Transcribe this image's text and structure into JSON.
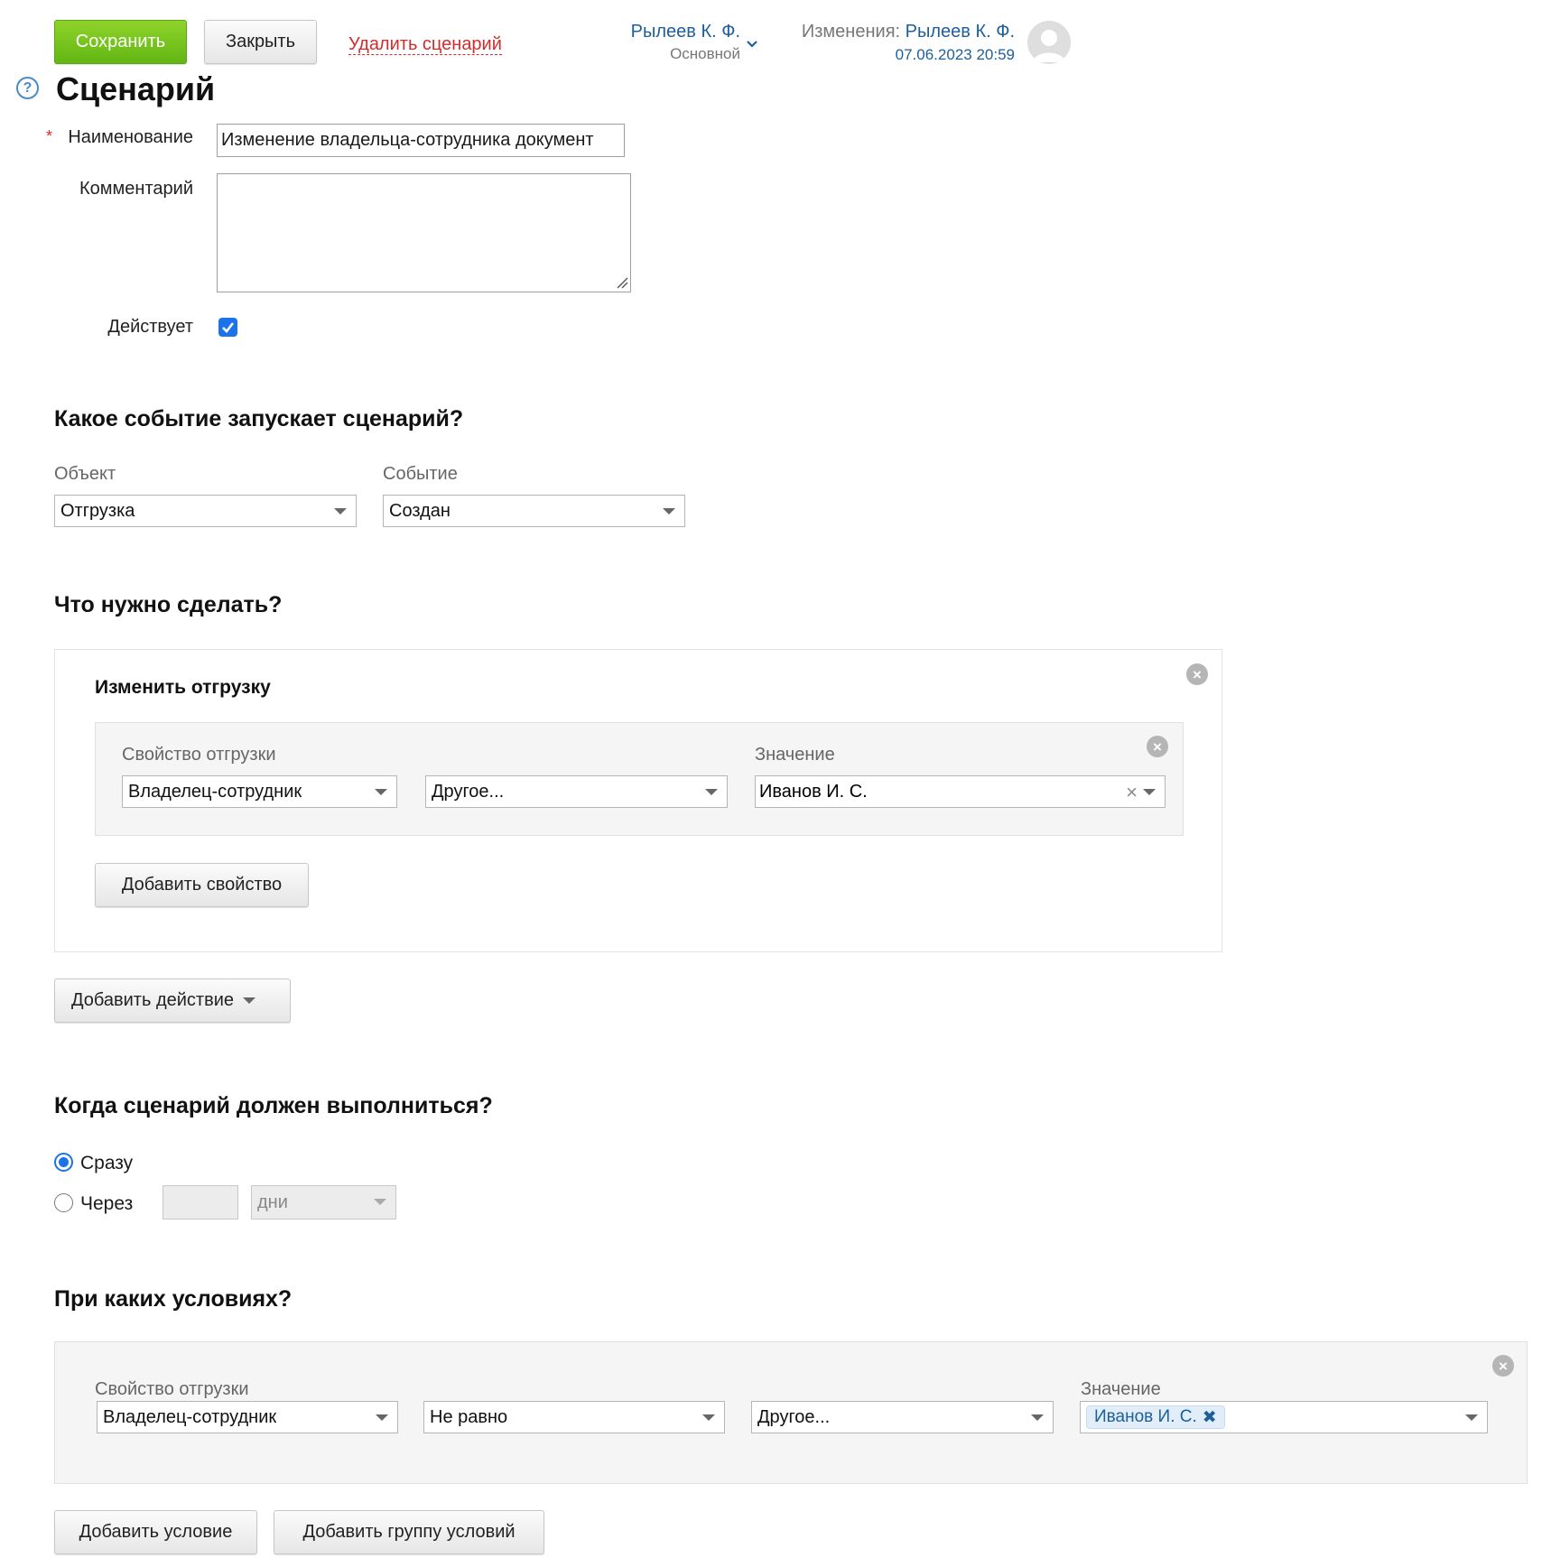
{
  "toolbar": {
    "save_label": "Сохранить",
    "close_label": "Закрыть",
    "delete_label": "Удалить сценарий"
  },
  "user": {
    "name": "Рылеев К. Ф.",
    "role": "Основной"
  },
  "changes": {
    "prefix": "Изменения:",
    "author": "Рылеев К. Ф.",
    "timestamp": "07.06.2023 20:59"
  },
  "page": {
    "help_glyph": "?",
    "title": "Сценарий"
  },
  "form": {
    "required_mark": "*",
    "name_label": "Наименование",
    "name_value": "Изменение владельца-сотрудника документ",
    "comment_label": "Комментарий",
    "comment_value": "",
    "active_label": "Действует",
    "active_checked": true
  },
  "trigger": {
    "heading": "Какое событие запускает сценарий?",
    "object_label": "Объект",
    "object_value": "Отгрузка",
    "event_label": "Событие",
    "event_value": "Создан"
  },
  "actions": {
    "heading": "Что нужно сделать?",
    "action_title": "Изменить отгрузку",
    "property_label": "Свойство отгрузки",
    "property_value": "Владелец-сотрудник",
    "mode_value": "Другое...",
    "value_label": "Значение",
    "value_value": "Иванов И. С.",
    "add_property_label": "Добавить свойство",
    "add_action_label": "Добавить действие"
  },
  "timing": {
    "heading": "Когда сценарий должен выполниться?",
    "option_now": "Сразу",
    "option_after": "Через",
    "selected": "now",
    "after_amount": "",
    "after_unit": "дни"
  },
  "conditions": {
    "heading": "При каких условиях?",
    "property_label": "Свойство отгрузки",
    "property_value": "Владелец-сотрудник",
    "operator_value": "Не равно",
    "mode_value": "Другое...",
    "value_label": "Значение",
    "value_tag": "Иванов И. С.",
    "add_condition_label": "Добавить условие",
    "add_group_label": "Добавить группу условий"
  },
  "colors": {
    "accent_green": "#62b613",
    "link_blue": "#1d5f9b",
    "danger_red": "#d42b2b",
    "checkbox_blue": "#1a73e8"
  },
  "icons": [
    "help-icon",
    "chevron-down-icon",
    "avatar-icon",
    "close-icon",
    "clear-icon",
    "checkbox-checked-icon"
  ]
}
